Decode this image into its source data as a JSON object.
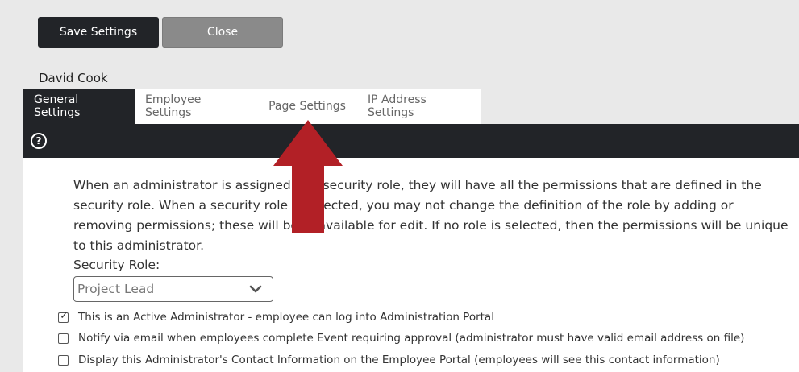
{
  "toolbar": {
    "save_label": "Save Settings",
    "close_label": "Close"
  },
  "user": {
    "name": "David Cook"
  },
  "tabs": [
    {
      "label": "General Settings",
      "active": true
    },
    {
      "label": "Employee Settings",
      "active": false
    },
    {
      "label": "Page Settings",
      "active": false
    },
    {
      "label": "IP Address Settings",
      "active": false
    }
  ],
  "help": {
    "icon": "?"
  },
  "general": {
    "description": "When an administrator is assigned to a security role, they will have all the permissions that are defined in the security role. When a security role is selected, you may not change the definition of the role by adding or removing permissions; these will be unavailable for edit. If no role is selected, then the permissions will be unique to this administrator.",
    "security_role_label": "Security Role:",
    "security_role_value": "Project Lead",
    "checkboxes": [
      {
        "label": "This is an Active Administrator - employee can log into Administration Portal",
        "checked": true
      },
      {
        "label": "Notify via email when employees complete Event requiring approval (administrator must have valid email address on file)",
        "checked": false
      },
      {
        "label": "Display this Administrator's Contact Information on the Employee Portal (employees will see this contact information)",
        "checked": false
      }
    ]
  },
  "colors": {
    "dark": "#222428",
    "arrow": "#b22026",
    "close_bg": "#8a8a8a",
    "page_bg": "#e9e9e9"
  }
}
